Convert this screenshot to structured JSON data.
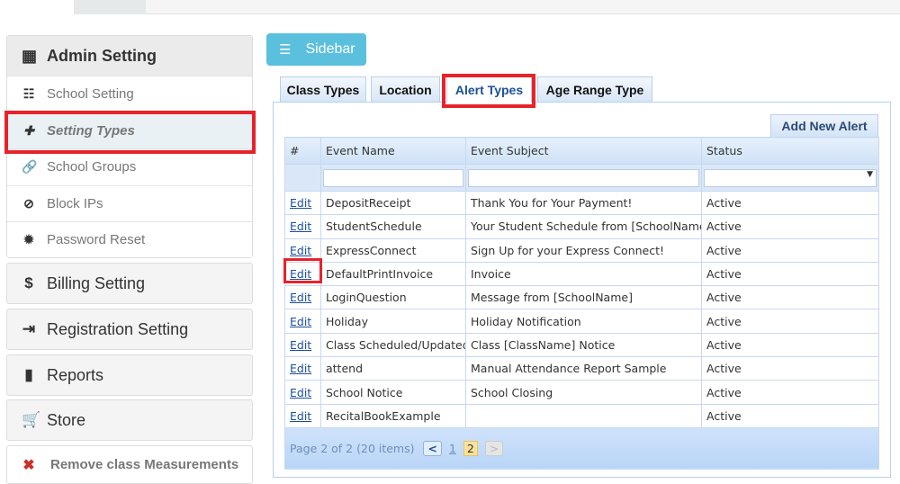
{
  "sidebar_button": {
    "label": "Sidebar",
    "icon": "align-left-icon",
    "color": "#5bc0de"
  },
  "sidebar": {
    "admin": {
      "title": "Admin Setting",
      "icon": "th-large-icon",
      "items": [
        {
          "label": "School Setting",
          "icon": "list-icon"
        },
        {
          "label": "Setting Types",
          "icon": "plus-icon",
          "active": true
        },
        {
          "label": "School Groups",
          "icon": "link-icon"
        },
        {
          "label": "Block IPs",
          "icon": "ban-icon"
        },
        {
          "label": "Password Reset",
          "icon": "cog-icon"
        }
      ]
    },
    "sections": [
      {
        "label": "Billing Setting",
        "icon": "dollar-icon"
      },
      {
        "label": "Registration Setting",
        "icon": "sign-in-icon"
      },
      {
        "label": "Reports",
        "icon": "bar-chart-icon"
      },
      {
        "label": "Store",
        "icon": "cart-icon"
      }
    ],
    "remove": {
      "label": "Remove class Measurements",
      "icon": "close-icon",
      "color": "#c9302c"
    }
  },
  "tabs": [
    {
      "label": "Class Types"
    },
    {
      "label": "Location"
    },
    {
      "label": "Alert Types",
      "active": true
    },
    {
      "label": "Age Range Type"
    }
  ],
  "grid": {
    "add_label": "Add New Alert",
    "columns": [
      "#",
      "Event Name",
      "Event Subject",
      "Status"
    ],
    "edit_label": "Edit",
    "rows": [
      [
        "DepositReceipt",
        "Thank You for Your Payment!",
        "Active"
      ],
      [
        "StudentSchedule",
        "Your Student Schedule from [SchoolName]",
        "Active"
      ],
      [
        "ExpressConnect",
        "Sign Up for your Express Connect!",
        "Active"
      ],
      [
        "DefaultPrintInvoice",
        "Invoice",
        "Active"
      ],
      [
        "LoginQuestion",
        "Message from [SchoolName]",
        "Active"
      ],
      [
        "Holiday",
        "Holiday Notification",
        "Active"
      ],
      [
        "Class Scheduled/Updated",
        "Class [ClassName] Notice",
        "Active"
      ],
      [
        "attend",
        "Manual Attendance Report Sample",
        "Active"
      ],
      [
        "School Notice",
        "School Closing",
        "Active"
      ],
      [
        "RecitalBookExample",
        "",
        "Active"
      ]
    ],
    "pager": {
      "summary": "Page 2 of 2 (20 items)",
      "pages": [
        "1",
        "2"
      ],
      "current": "2"
    }
  }
}
